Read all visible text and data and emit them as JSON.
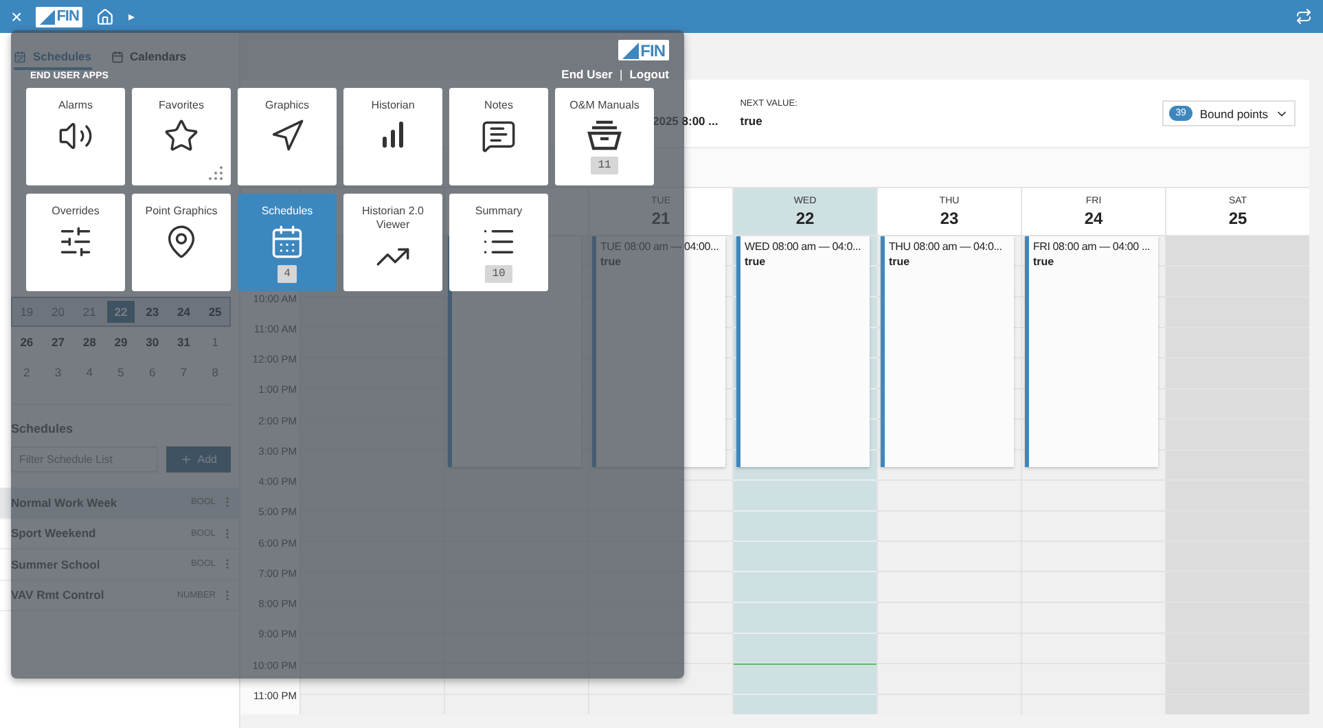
{
  "top_bar": {
    "close": "×",
    "logo_text": "FIN",
    "breadcrumb_caret": "▸"
  },
  "sidebar": {
    "tabs": [
      {
        "label": "Schedules",
        "selected": true
      },
      {
        "label": "Calendars",
        "selected": false
      }
    ],
    "mini_calendar": {
      "weeks": [
        {
          "current_week": true,
          "days": [
            {
              "day": "19",
              "muted": true,
              "selected": false
            },
            {
              "day": "20",
              "muted": true,
              "selected": false
            },
            {
              "day": "21",
              "muted": true,
              "selected": false
            },
            {
              "day": "22",
              "muted": false,
              "selected": true
            },
            {
              "day": "23",
              "muted": false,
              "selected": false
            },
            {
              "day": "24",
              "muted": false,
              "selected": false
            },
            {
              "day": "25",
              "muted": false,
              "selected": false
            }
          ]
        },
        {
          "current_week": false,
          "days": [
            {
              "day": "26",
              "muted": false,
              "selected": false
            },
            {
              "day": "27",
              "muted": false,
              "selected": false
            },
            {
              "day": "28",
              "muted": false,
              "selected": false
            },
            {
              "day": "29",
              "muted": false,
              "selected": false
            },
            {
              "day": "30",
              "muted": false,
              "selected": false
            },
            {
              "day": "31",
              "muted": false,
              "selected": false
            },
            {
              "day": "1",
              "muted": true,
              "selected": false
            }
          ]
        },
        {
          "current_week": false,
          "days": [
            {
              "day": "2",
              "muted": true,
              "selected": false
            },
            {
              "day": "3",
              "muted": true,
              "selected": false
            },
            {
              "day": "4",
              "muted": true,
              "selected": false
            },
            {
              "day": "5",
              "muted": true,
              "selected": false
            },
            {
              "day": "6",
              "muted": true,
              "selected": false
            },
            {
              "day": "7",
              "muted": true,
              "selected": false
            },
            {
              "day": "8",
              "muted": true,
              "selected": false
            }
          ]
        }
      ]
    },
    "schedules_heading": "Schedules",
    "filter": {
      "placeholder": "Filter Schedule List"
    },
    "add_button": "Add",
    "schedules": [
      {
        "name": "Normal Work Week",
        "type": "BOOL",
        "selected": true
      },
      {
        "name": "Sport Weekend",
        "type": "BOOL",
        "selected": false
      },
      {
        "name": "Summer School",
        "type": "BOOL",
        "selected": false
      },
      {
        "name": "VAV Rmt Control",
        "type": "NUMBER",
        "selected": false
      }
    ]
  },
  "info_card": {
    "current_value_fragment": "2025 8:00 ...",
    "next_value_label": "NEXT VALUE:",
    "next_value": "true",
    "bound_points": {
      "count": "39",
      "label": "Bound points"
    }
  },
  "calendar": {
    "time_labels": [
      "10:00 AM",
      "11:00 AM",
      "12:00 PM",
      "1:00 PM",
      "2:00 PM",
      "3:00 PM",
      "4:00 PM",
      "5:00 PM",
      "6:00 PM",
      "7:00 PM",
      "8:00 PM",
      "9:00 PM",
      "10:00 PM",
      "11:00 PM"
    ],
    "days": [
      {
        "today": false,
        "weekend": false,
        "has_event": false
      },
      {
        "today": false,
        "weekend": false,
        "has_event": true
      },
      {
        "weekday": "TUE",
        "date": "21",
        "today": false,
        "weekend": false,
        "has_event": true,
        "event_time": "TUE 08:00 am — 04:00...",
        "event_value": "true"
      },
      {
        "weekday": "WED",
        "date": "22",
        "today": true,
        "weekend": false,
        "has_event": true,
        "event_time": "WED 08:00 am — 04:0...",
        "event_value": "true"
      },
      {
        "weekday": "THU",
        "date": "23",
        "today": false,
        "weekend": false,
        "has_event": true,
        "event_time": "THU 08:00 am — 04:0...",
        "event_value": "true"
      },
      {
        "weekday": "FRI",
        "date": "24",
        "today": false,
        "weekend": false,
        "has_event": true,
        "event_time": "FRI 08:00 am — 04:00 ...",
        "event_value": "true"
      },
      {
        "weekday": "SAT",
        "date": "25",
        "today": false,
        "weekend": true,
        "has_event": false
      }
    ]
  },
  "app_launcher": {
    "section_label": "END USER APPS",
    "logo_text": "FIN",
    "user": "End User",
    "separator": "|",
    "logout": "Logout",
    "tiles": [
      {
        "label": "Alarms",
        "selected": false
      },
      {
        "label": "Favorites",
        "selected": false
      },
      {
        "label": "Graphics",
        "selected": false
      },
      {
        "label": "Historian",
        "selected": false
      },
      {
        "label": "Notes",
        "selected": false
      },
      {
        "label": "O&M Manuals",
        "count": "11",
        "selected": false
      },
      {
        "label": "Overrides",
        "selected": false
      },
      {
        "label": "Point Graphics",
        "selected": false
      },
      {
        "label": "Schedules",
        "count": "4",
        "selected": true
      },
      {
        "label": "Historian 2.0 Viewer",
        "selected": false
      },
      {
        "label": "Summary",
        "count": "10",
        "selected": false
      }
    ]
  }
}
